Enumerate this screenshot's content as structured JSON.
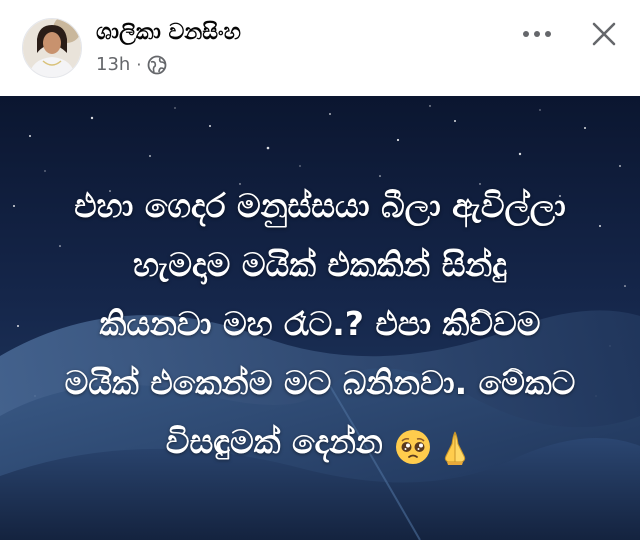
{
  "post": {
    "author_name": "ශාලිකා වනසිංහ",
    "time": "13h",
    "separator": "·",
    "privacy_icon": "globe-icon",
    "more_icon": "more-horizontal-icon",
    "close_icon": "close-icon"
  },
  "image_text": {
    "lines": [
      "එහා ගෙදර මනුස්සයා බීලා ඇවිල්ලා",
      "හැමදාම මයික් එකකින් සින්දු",
      "කියනවා මහ රෑට.? එපා කිව්වම",
      "මයික් එකෙන්ම මට බනිනවා. මේකට",
      "විසඳුමක් දෙන්න"
    ],
    "emojis": [
      "pleading-face-emoji",
      "folded-hands-emoji"
    ]
  },
  "colors": {
    "name": "#050505",
    "meta": "#65676b",
    "image_top": "#0e1a33",
    "image_bottom": "#2c4468",
    "dune": "#3c5a82"
  }
}
